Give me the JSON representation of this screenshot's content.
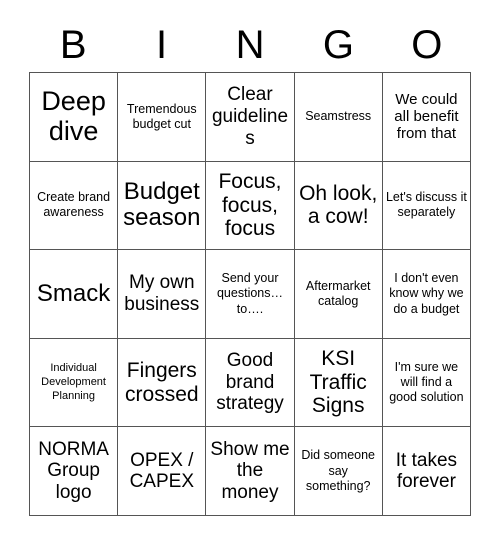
{
  "card": {
    "title": "BINGO",
    "header_letters": [
      "B",
      "I",
      "N",
      "G",
      "O"
    ],
    "columns": 5,
    "rows": 5,
    "border_color": "#555555",
    "background_color": "#ffffff",
    "text_color": "#000000",
    "cells": [
      {
        "text": "Deep dive",
        "size": "fs-xxl"
      },
      {
        "text": "Tremendous budget cut",
        "size": "fs-xs"
      },
      {
        "text": "Clear guidelines",
        "size": "fs-md"
      },
      {
        "text": "Seamstress",
        "size": "fs-xs"
      },
      {
        "text": "We could all benefit from that",
        "size": "fs-sm"
      },
      {
        "text": "Create brand awareness",
        "size": "fs-xs"
      },
      {
        "text": "Budget season",
        "size": "fs-xl"
      },
      {
        "text": "Focus, focus, focus",
        "size": "fs-lg"
      },
      {
        "text": "Oh look, a cow!",
        "size": "fs-lg"
      },
      {
        "text": "Let's discuss it separately",
        "size": "fs-xs"
      },
      {
        "text": "Smack",
        "size": "fs-xl"
      },
      {
        "text": "My own business",
        "size": "fs-md"
      },
      {
        "text": "Send your questions… to….",
        "size": "fs-xs"
      },
      {
        "text": "Aftermarket catalog",
        "size": "fs-xs"
      },
      {
        "text": "I don't even know why we do a budget",
        "size": "fs-xs"
      },
      {
        "text": "Individual Development Planning",
        "size": "fs-xxs"
      },
      {
        "text": "Fingers crossed",
        "size": "fs-lg"
      },
      {
        "text": "Good brand strategy",
        "size": "fs-md"
      },
      {
        "text": "KSI Traffic Signs",
        "size": "fs-lg"
      },
      {
        "text": "I'm sure we will find a good solution",
        "size": "fs-xs"
      },
      {
        "text": "NORMA Group logo",
        "size": "fs-md"
      },
      {
        "text": "OPEX / CAPEX",
        "size": "fs-md"
      },
      {
        "text": "Show me the money",
        "size": "fs-md"
      },
      {
        "text": "Did someone say something?",
        "size": "fs-xs"
      },
      {
        "text": "It takes forever",
        "size": "fs-md"
      }
    ]
  }
}
